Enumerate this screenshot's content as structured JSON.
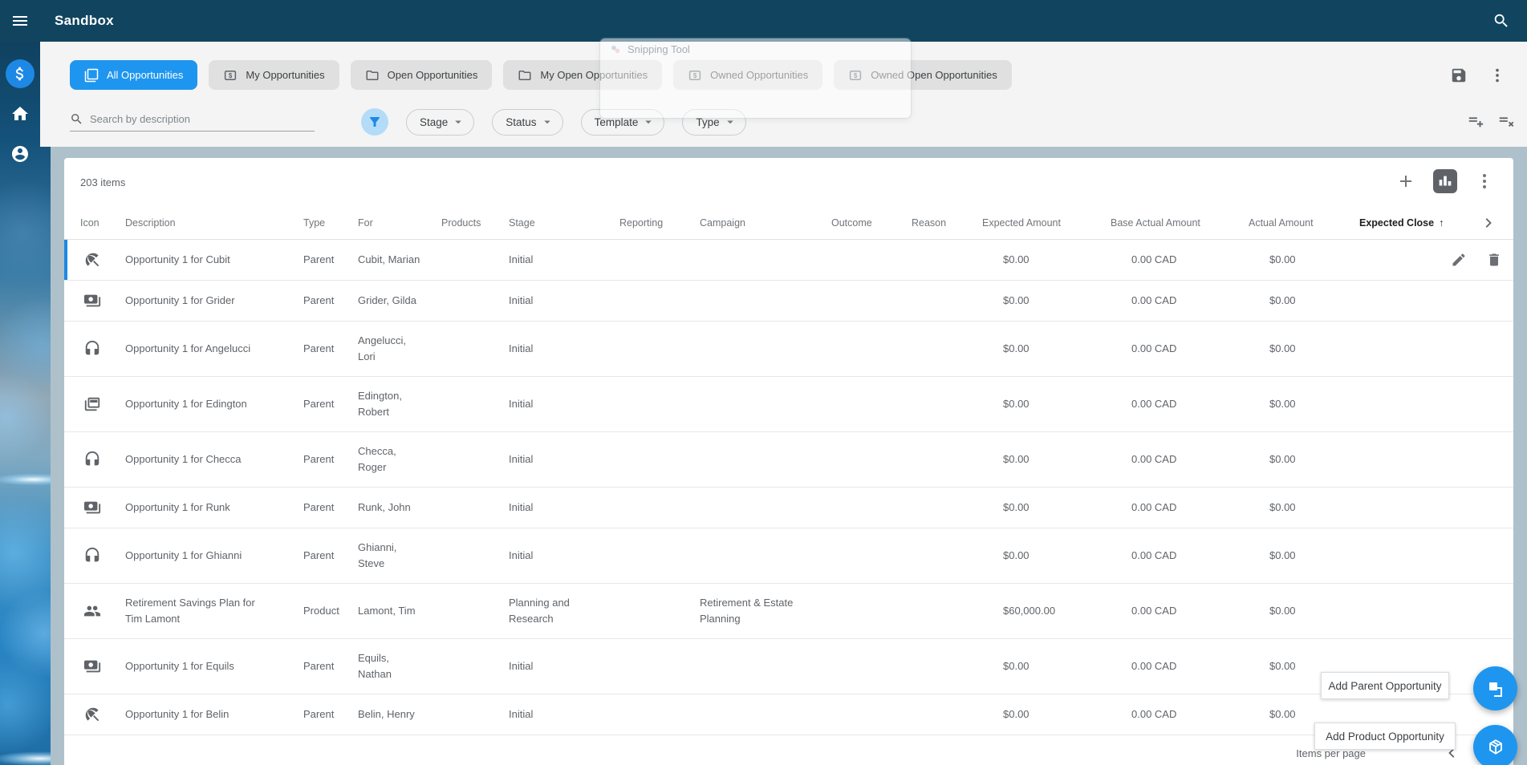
{
  "header": {
    "title": "Sandbox"
  },
  "sidebar": {
    "items": [
      {
        "name": "opportunities",
        "icon": "dollar",
        "active": true
      },
      {
        "name": "home",
        "icon": "home",
        "active": false
      },
      {
        "name": "account",
        "icon": "account",
        "active": false
      }
    ]
  },
  "tabs": [
    {
      "label": "All Opportunities",
      "icon": "stack",
      "active": true
    },
    {
      "label": "My Opportunities",
      "icon": "dollar-box",
      "active": false
    },
    {
      "label": "Open Opportunities",
      "icon": "folder",
      "active": false
    },
    {
      "label": "My Open Opportunities",
      "icon": "folder",
      "active": false
    },
    {
      "label": "Owned Opportunities",
      "icon": "dollar-box",
      "active": false
    },
    {
      "label": "Owned Open Opportunities",
      "icon": "dollar-box",
      "active": false
    }
  ],
  "view_actions": {
    "save_icon": "save",
    "more_icon": "kebab"
  },
  "filters": {
    "search_placeholder": "Search by description",
    "filter_icon": "funnel",
    "dropdowns": [
      "Stage",
      "Status",
      "Template",
      "Type"
    ],
    "row_config_icons": [
      "rows-add",
      "rows-remove"
    ]
  },
  "ghost": {
    "title": "Snipping Tool"
  },
  "grid": {
    "count_label": "203 items",
    "toolbar_icons": [
      "plus",
      "chart",
      "kebab"
    ],
    "columns": [
      {
        "label": "Icon",
        "key": "icon"
      },
      {
        "label": "Description",
        "key": "desc"
      },
      {
        "label": "Type",
        "key": "type"
      },
      {
        "label": "For",
        "key": "for"
      },
      {
        "label": "Products",
        "key": "products"
      },
      {
        "label": "Stage",
        "key": "stage"
      },
      {
        "label": "Reporting",
        "key": "reporting"
      },
      {
        "label": "Campaign",
        "key": "campaign"
      },
      {
        "label": "Outcome",
        "key": "outcome"
      },
      {
        "label": "Reason",
        "key": "reason"
      },
      {
        "label": "Expected Amount",
        "key": "expected"
      },
      {
        "label": "Base Actual Amount",
        "key": "base"
      },
      {
        "label": "Actual Amount",
        "key": "actual"
      },
      {
        "label": "Expected Close",
        "key": "close",
        "sorted": "asc"
      }
    ],
    "rows": [
      {
        "icon": "umbrella",
        "description": [
          "Opportunity 1 for Cubit"
        ],
        "type": "Parent",
        "for": [
          "Cubit, Marian"
        ],
        "stage": [
          "Initial"
        ],
        "campaign": [],
        "expected": "$0.00",
        "base": "0.00 CAD",
        "actual": "$0.00",
        "selected": true
      },
      {
        "icon": "payments",
        "description": [
          "Opportunity 1 for Grider"
        ],
        "type": "Parent",
        "for": [
          "Grider, Gilda"
        ],
        "stage": [
          "Initial"
        ],
        "campaign": [],
        "expected": "$0.00",
        "base": "0.00 CAD",
        "actual": "$0.00",
        "selected": false
      },
      {
        "icon": "headset",
        "description": [
          "Opportunity 1 for Angelucci"
        ],
        "type": "Parent",
        "for": [
          "Angelucci,",
          "Lori"
        ],
        "stage": [
          "Initial"
        ],
        "campaign": [],
        "expected": "$0.00",
        "base": "0.00 CAD",
        "actual": "$0.00",
        "selected": false
      },
      {
        "icon": "cards",
        "description": [
          "Opportunity 1 for Edington"
        ],
        "type": "Parent",
        "for": [
          "Edington,",
          "Robert"
        ],
        "stage": [
          "Initial"
        ],
        "campaign": [],
        "expected": "$0.00",
        "base": "0.00 CAD",
        "actual": "$0.00",
        "selected": false
      },
      {
        "icon": "headset",
        "description": [
          "Opportunity 1 for Checca"
        ],
        "type": "Parent",
        "for": [
          "Checca,",
          "Roger"
        ],
        "stage": [
          "Initial"
        ],
        "campaign": [],
        "expected": "$0.00",
        "base": "0.00 CAD",
        "actual": "$0.00",
        "selected": false
      },
      {
        "icon": "payments",
        "description": [
          "Opportunity 1 for Runk"
        ],
        "type": "Parent",
        "for": [
          "Runk, John"
        ],
        "stage": [
          "Initial"
        ],
        "campaign": [],
        "expected": "$0.00",
        "base": "0.00 CAD",
        "actual": "$0.00",
        "selected": false
      },
      {
        "icon": "headset",
        "description": [
          "Opportunity 1 for Ghianni"
        ],
        "type": "Parent",
        "for": [
          "Ghianni,",
          "Steve"
        ],
        "stage": [
          "Initial"
        ],
        "campaign": [],
        "expected": "$0.00",
        "base": "0.00 CAD",
        "actual": "$0.00",
        "selected": false
      },
      {
        "icon": "people",
        "description": [
          "Retirement Savings Plan for",
          "Tim Lamont"
        ],
        "type": "Product",
        "for": [
          "Lamont, Tim"
        ],
        "stage": [
          "Planning and",
          "Research"
        ],
        "campaign": [
          "Retirement & Estate",
          "Planning"
        ],
        "expected": "$60,000.00",
        "base": "0.00 CAD",
        "actual": "$0.00",
        "selected": false
      },
      {
        "icon": "payments",
        "description": [
          "Opportunity 1 for Equils"
        ],
        "type": "Parent",
        "for": [
          "Equils,",
          "Nathan"
        ],
        "stage": [
          "Initial"
        ],
        "campaign": [],
        "expected": "$0.00",
        "base": "0.00 CAD",
        "actual": "$0.00",
        "selected": false
      },
      {
        "icon": "umbrella",
        "description": [
          "Opportunity 1 for Belin"
        ],
        "type": "Parent",
        "for": [
          "Belin, Henry"
        ],
        "stage": [
          "Initial"
        ],
        "campaign": [],
        "expected": "$0.00",
        "base": "0.00 CAD",
        "actual": "$0.00",
        "selected": false
      }
    ],
    "row_action_icons": [
      "pencil",
      "trash"
    ]
  },
  "fabs": [
    {
      "tooltip": "Add Parent Opportunity",
      "icon": "flip-front"
    },
    {
      "tooltip": "Add Product Opportunity",
      "icon": "cube"
    }
  ],
  "pagination": {
    "label": "Items per page"
  },
  "colors": {
    "accent": "#1e96ef",
    "sidebar_accent": "#1e88e5",
    "topbar": "#11455f",
    "grid_backdrop": "#aec1cb",
    "panel": "#f4f4f4",
    "inactive_tab": "#e0e0e0"
  }
}
